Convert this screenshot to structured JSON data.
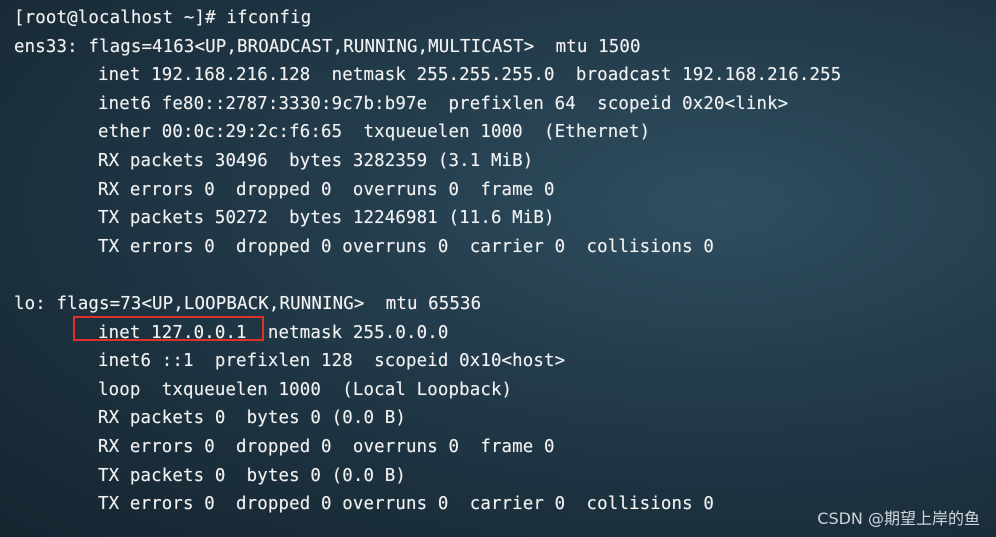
{
  "terminal": {
    "lines": [
      {
        "text": "[root@localhost ~]# ifconfig",
        "indent": false
      },
      {
        "text": "ens33: flags=4163<UP,BROADCAST,RUNNING,MULTICAST>  mtu 1500",
        "indent": false
      },
      {
        "text": "inet 192.168.216.128  netmask 255.255.255.0  broadcast 192.168.216.255",
        "indent": true
      },
      {
        "text": "inet6 fe80::2787:3330:9c7b:b97e  prefixlen 64  scopeid 0x20<link>",
        "indent": true
      },
      {
        "text": "ether 00:0c:29:2c:f6:65  txqueuelen 1000  (Ethernet)",
        "indent": true
      },
      {
        "text": "RX packets 30496  bytes 3282359 (3.1 MiB)",
        "indent": true
      },
      {
        "text": "RX errors 0  dropped 0  overruns 0  frame 0",
        "indent": true
      },
      {
        "text": "TX packets 50272  bytes 12246981 (11.6 MiB)",
        "indent": true
      },
      {
        "text": "TX errors 0  dropped 0 overruns 0  carrier 0  collisions 0",
        "indent": true
      },
      {
        "text": "",
        "indent": false
      },
      {
        "text": "lo: flags=73<UP,LOOPBACK,RUNNING>  mtu 65536",
        "indent": false
      },
      {
        "text": "inet 127.0.0.1  netmask 255.0.0.0",
        "indent": true
      },
      {
        "text": "inet6 ::1  prefixlen 128  scopeid 0x10<host>",
        "indent": true
      },
      {
        "text": "loop  txqueuelen 1000  (Local Loopback)",
        "indent": true
      },
      {
        "text": "RX packets 0  bytes 0 (0.0 B)",
        "indent": true
      },
      {
        "text": "RX errors 0  dropped 0  overruns 0  frame 0",
        "indent": true
      },
      {
        "text": "TX packets 0  bytes 0 (0.0 B)",
        "indent": true
      },
      {
        "text": "TX errors 0  dropped 0 overruns 0  carrier 0  collisions 0",
        "indent": true
      }
    ]
  },
  "watermark": "CSDN @期望上岸的鱼",
  "colors": {
    "highlight": "#e0302a",
    "text": "#f2f2f2",
    "background": "#1f3645"
  }
}
